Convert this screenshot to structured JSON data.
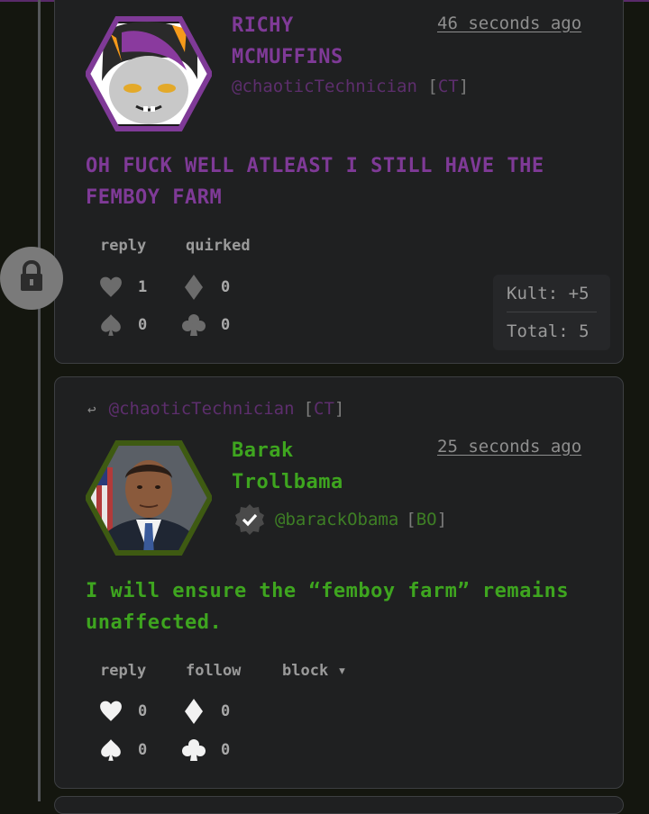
{
  "colors": {
    "purple": "#7f3a97",
    "purple_dim": "#5d2e6d",
    "green": "#3ea51f",
    "green_dim": "#3e7f25",
    "gray_text": "#9a9a9a"
  },
  "post1": {
    "name": "RICHY\nMCMUFFINS",
    "timestamp": "46 seconds ago",
    "handle": "@chaoticTechnician",
    "code_open": "[",
    "code": "CT",
    "code_close": "]",
    "body": "OH FUCK WELL ATLEAST I STILL HAVE THE FEMBOY FARM",
    "actions": [
      "reply",
      "quirked"
    ],
    "stats": {
      "heart": "1",
      "diamond": "0",
      "spade": "0",
      "club": "0"
    },
    "kult": "Kult: +5",
    "total": "Total: 5"
  },
  "lock": {
    "icon": "lock-icon"
  },
  "post2": {
    "reply_arrow": "↩",
    "reply_handle": "@chaoticTechnician",
    "reply_code_open": "[",
    "reply_code": "CT",
    "reply_code_close": "]",
    "name": "Barak\nTrollbama",
    "timestamp": "25 seconds ago",
    "verified_icon": "verified-badge-icon",
    "handle": "@barackObama",
    "code_open": "[",
    "code": "BO",
    "code_close": "]",
    "body": "I will ensure the “femboy farm” remains unaffected.",
    "actions": [
      "reply",
      "follow",
      "block ▾"
    ],
    "stats": {
      "heart": "0",
      "diamond": "0",
      "spade": "0",
      "club": "0"
    }
  }
}
